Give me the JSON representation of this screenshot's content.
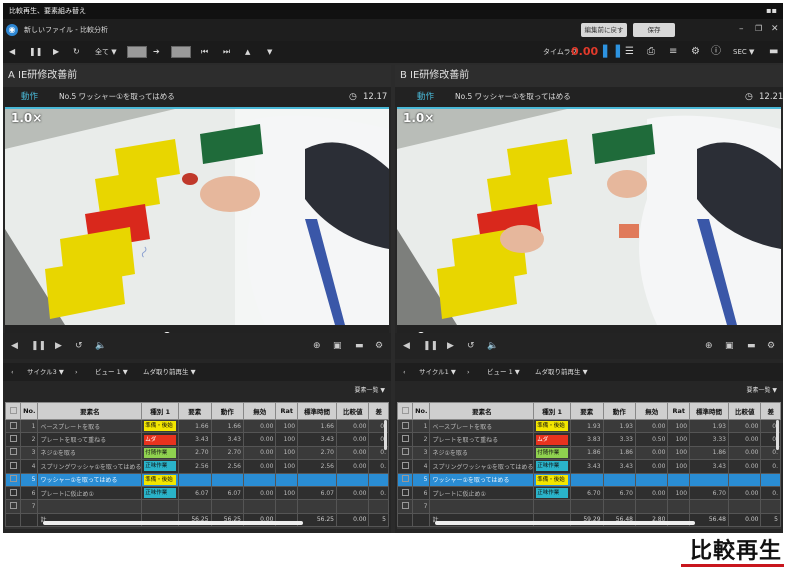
{
  "window": {
    "title": "比較再生、要素組み替え"
  },
  "menu": {
    "breadcrumb": "新しいファイル - 比較分析",
    "reset_label": "編集前に戻す",
    "save_label": "保存"
  },
  "toolbar": {
    "all_label": "全て",
    "timelag_label": "タイムラグ",
    "timelag_value": "0.00",
    "unit_label": "SEC"
  },
  "panels": [
    {
      "header": "A  IE研修改善前",
      "tab": "動作",
      "element_title": "No.5 ワッシャー①を取ってはめる",
      "time": "12.17",
      "speed": "1.0×",
      "seek_fraction": 0.42,
      "cycle_label": "サイクル3",
      "view_label": "ビュー 1",
      "muda_label": "ムダ取り前再生",
      "elements_label": "要素一覧",
      "columns": [
        "No.",
        "要素名",
        "種別 1",
        "要素",
        "動作",
        "無効",
        "Rat",
        "標準時間",
        "比較値",
        "差"
      ],
      "rows": [
        {
          "no": "1",
          "name": "ベースプレートを取る",
          "type": "準備・後始",
          "tc": "#f3e600",
          "el": "1.66",
          "mv": "1.66",
          "inv": "0.00",
          "rat": "100",
          "std": "1.66",
          "cmp": "0.00",
          "diff": "0."
        },
        {
          "no": "2",
          "name": "プレートを取って重ねる",
          "type": "ムダ",
          "tc": "#e8321e",
          "el": "3.43",
          "mv": "3.43",
          "inv": "0.00",
          "rat": "100",
          "std": "3.43",
          "cmp": "0.00",
          "diff": "0."
        },
        {
          "no": "3",
          "name": "ネジ①を取る",
          "type": "付随作業",
          "tc": "#8fd14f",
          "el": "2.70",
          "mv": "2.70",
          "inv": "0.00",
          "rat": "100",
          "std": "2.70",
          "cmp": "0.00",
          "diff": "0."
        },
        {
          "no": "4",
          "name": "スプリングワッシャ①を取ってはめる",
          "type": "正味作業",
          "tc": "#2ab3c9",
          "el": "2.56",
          "mv": "2.56",
          "inv": "0.00",
          "rat": "100",
          "std": "2.56",
          "cmp": "0.00",
          "diff": "0."
        },
        {
          "no": "5",
          "name": "ワッシャー①を取ってはめる",
          "type": "準備・後始",
          "tc": "#f3e600",
          "el": "",
          "mv": "",
          "inv": "",
          "rat": "",
          "std": "",
          "cmp": "",
          "diff": "",
          "sel": true
        },
        {
          "no": "6",
          "name": "プレートに仮止め①",
          "type": "正味作業",
          "tc": "#2ab3c9",
          "el": "6.07",
          "mv": "6.07",
          "inv": "0.00",
          "rat": "100",
          "std": "6.07",
          "cmp": "0.00",
          "diff": "0."
        },
        {
          "no": "7",
          "name": "",
          "type": "",
          "tc": "",
          "el": "",
          "mv": "",
          "inv": "",
          "rat": "",
          "std": "",
          "cmp": "",
          "diff": ""
        }
      ],
      "total": {
        "label": "計",
        "el": "56.25",
        "mv": "56.25",
        "inv": "0.00",
        "std": "56.25",
        "cmp": "0.00",
        "diff": "5"
      }
    },
    {
      "header": "B  IE研修改善前",
      "tab": "動作",
      "element_title": "No.5 ワッシャー①を取ってはめる",
      "time": "12.21",
      "speed": "1.0×",
      "seek_fraction": 0.06,
      "cycle_label": "サイクル1",
      "view_label": "ビュー 1",
      "muda_label": "ムダ取り前再生",
      "elements_label": "要素一覧",
      "columns": [
        "No.",
        "要素名",
        "種別 1",
        "要素",
        "動作",
        "無効",
        "Rat",
        "標準時間",
        "比較値",
        "差"
      ],
      "rows": [
        {
          "no": "1",
          "name": "ベースプレートを取る",
          "type": "準備・後始",
          "tc": "#f3e600",
          "el": "1.93",
          "mv": "1.93",
          "inv": "0.00",
          "rat": "100",
          "std": "1.93",
          "cmp": "0.00",
          "diff": "0."
        },
        {
          "no": "2",
          "name": "プレートを取って重ねる",
          "type": "ムダ",
          "tc": "#e8321e",
          "el": "3.83",
          "mv": "3.33",
          "inv": "0.50",
          "rat": "100",
          "std": "3.33",
          "cmp": "0.00",
          "diff": "0."
        },
        {
          "no": "3",
          "name": "ネジ①を取る",
          "type": "付随作業",
          "tc": "#8fd14f",
          "el": "1.86",
          "mv": "1.86",
          "inv": "0.00",
          "rat": "100",
          "std": "1.86",
          "cmp": "0.00",
          "diff": "0."
        },
        {
          "no": "4",
          "name": "スプリングワッシャ①を取ってはめる",
          "type": "正味作業",
          "tc": "#2ab3c9",
          "el": "3.43",
          "mv": "3.43",
          "inv": "0.00",
          "rat": "100",
          "std": "3.43",
          "cmp": "0.00",
          "diff": "0."
        },
        {
          "no": "5",
          "name": "ワッシャー①を取ってはめる",
          "type": "準備・後始",
          "tc": "#f3e600",
          "el": "",
          "mv": "",
          "inv": "",
          "rat": "",
          "std": "",
          "cmp": "",
          "diff": "",
          "sel": true
        },
        {
          "no": "6",
          "name": "プレートに仮止め①",
          "type": "正味作業",
          "tc": "#2ab3c9",
          "el": "6.70",
          "mv": "6.70",
          "inv": "0.00",
          "rat": "100",
          "std": "6.70",
          "cmp": "0.00",
          "diff": "0."
        },
        {
          "no": "7",
          "name": "",
          "type": "",
          "tc": "",
          "el": "",
          "mv": "",
          "inv": "",
          "rat": "",
          "std": "",
          "cmp": "",
          "diff": ""
        }
      ],
      "total": {
        "label": "計",
        "el": "59.29",
        "mv": "56.48",
        "inv": "2.80",
        "std": "56.48",
        "cmp": "0.00",
        "diff": "5"
      }
    }
  ],
  "caption": "比較再生"
}
